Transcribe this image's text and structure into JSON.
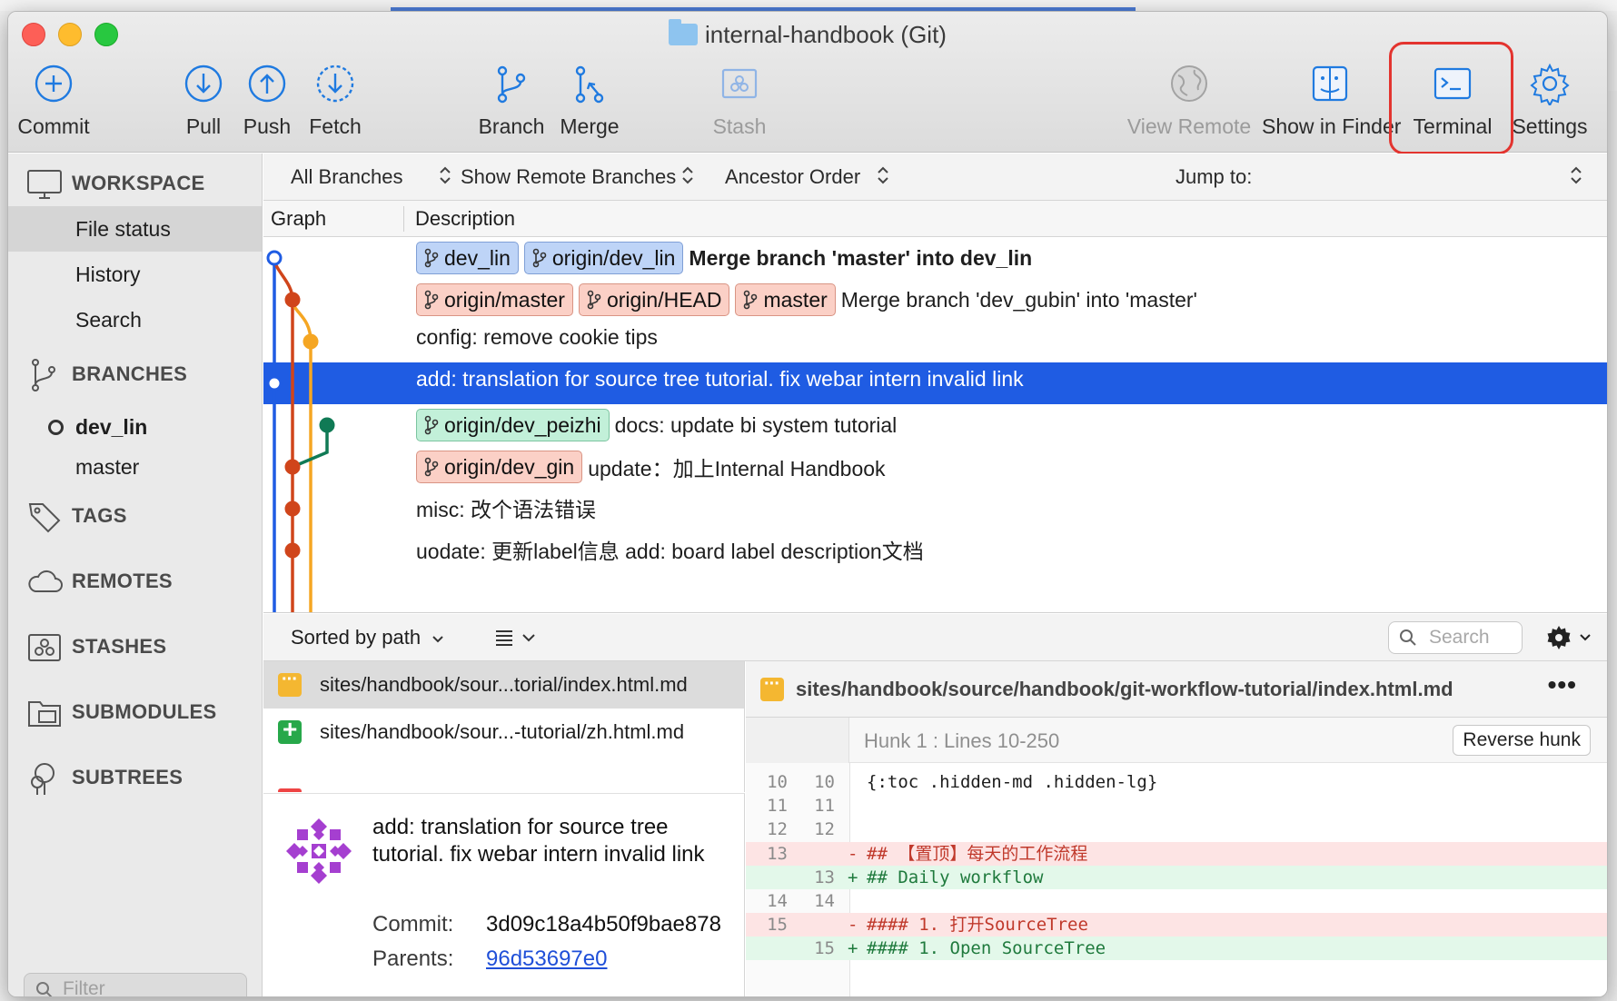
{
  "window": {
    "title": "internal-handbook (Git)"
  },
  "toolbar": {
    "commit": "Commit",
    "pull": "Pull",
    "push": "Push",
    "fetch": "Fetch",
    "branch": "Branch",
    "merge": "Merge",
    "stash": "Stash",
    "view_remote": "View Remote",
    "show_in_finder": "Show in Finder",
    "terminal": "Terminal",
    "settings": "Settings"
  },
  "sidebar": {
    "workspace": "WORKSPACE",
    "file_status": "File status",
    "history": "History",
    "search": "Search",
    "branches": "BRANCHES",
    "branch_items": [
      "dev_lin",
      "master"
    ],
    "tags": "TAGS",
    "remotes": "REMOTES",
    "stashes": "STASHES",
    "submodules": "SUBMODULES",
    "subtrees": "SUBTREES",
    "filter_placeholder": "Filter"
  },
  "filters": {
    "branches": "All Branches",
    "remote": "Show Remote Branches",
    "order": "Ancestor Order",
    "jump_to": "Jump to:"
  },
  "columns": {
    "graph": "Graph",
    "description": "Description"
  },
  "commits": [
    {
      "tags": [
        {
          "name": "dev_lin",
          "color": "blue"
        },
        {
          "name": "origin/dev_lin",
          "color": "blue"
        }
      ],
      "message": "Merge branch 'master' into dev_lin",
      "bold": true
    },
    {
      "tags": [
        {
          "name": "origin/master",
          "color": "red"
        },
        {
          "name": "origin/HEAD",
          "color": "red"
        },
        {
          "name": "master",
          "color": "red"
        }
      ],
      "message": "Merge branch 'dev_gubin' into 'master'"
    },
    {
      "tags": [],
      "message": "config: remove cookie tips"
    },
    {
      "tags": [],
      "message": "add: translation for source tree tutorial. fix webar intern invalid link",
      "selected": true
    },
    {
      "tags": [
        {
          "name": "origin/dev_peizhi",
          "color": "green"
        }
      ],
      "message": "docs: update bi system tutorial"
    },
    {
      "tags": [
        {
          "name": "origin/dev_gin",
          "color": "red"
        }
      ],
      "message": "update：加上Internal Handbook"
    },
    {
      "tags": [],
      "message": "misc: 改个语法错误"
    },
    {
      "tags": [],
      "message": "uodate: 更新label信息 add: board label description文档"
    }
  ],
  "files_bar": {
    "sort": "Sorted by path",
    "search_placeholder": "Search"
  },
  "files": [
    {
      "name": "sites/handbook/sour...torial/index.html.md",
      "status": "modified",
      "selected": true
    },
    {
      "name": "sites/handbook/sour...-tutorial/zh.html.md",
      "status": "added"
    }
  ],
  "commit_detail": {
    "message": "add: translation for source tree tutorial. fix webar intern invalid link",
    "commit_label": "Commit:",
    "commit_hash": "3d09c18a4b50f9bae878",
    "parents_label": "Parents:",
    "parent_hash": "96d53697e0"
  },
  "diff": {
    "file_path": "sites/handbook/source/handbook/git-workflow-tutorial/index.html.md",
    "hunk_label": "Hunk 1 : Lines 10-250",
    "reverse_hunk": "Reverse hunk",
    "lines": [
      {
        "old": "10",
        "new": "10",
        "sign": "",
        "text": "{:toc .hidden-md .hidden-lg}",
        "type": "ctx"
      },
      {
        "old": "11",
        "new": "11",
        "sign": "",
        "text": "",
        "type": "ctx"
      },
      {
        "old": "12",
        "new": "12",
        "sign": "",
        "text": "",
        "type": "ctx"
      },
      {
        "old": "13",
        "new": "",
        "sign": "-",
        "text": "## 【置顶】每天的工作流程",
        "type": "del"
      },
      {
        "old": "",
        "new": "13",
        "sign": "+",
        "text": "## Daily workflow",
        "type": "add"
      },
      {
        "old": "14",
        "new": "14",
        "sign": "",
        "text": "",
        "type": "ctx"
      },
      {
        "old": "15",
        "new": "",
        "sign": "-",
        "text": "#### 1. 打开SourceTree",
        "type": "del"
      },
      {
        "old": "",
        "new": "15",
        "sign": "+",
        "text": "#### 1. Open SourceTree",
        "type": "add"
      }
    ]
  },
  "colors": {
    "selection": "#1f5ce3",
    "highlight_box": "#e3342f",
    "graph_blue": "#1f5ce3",
    "graph_red": "#d0451b",
    "graph_orange": "#f5a623",
    "graph_green": "#107a55"
  }
}
